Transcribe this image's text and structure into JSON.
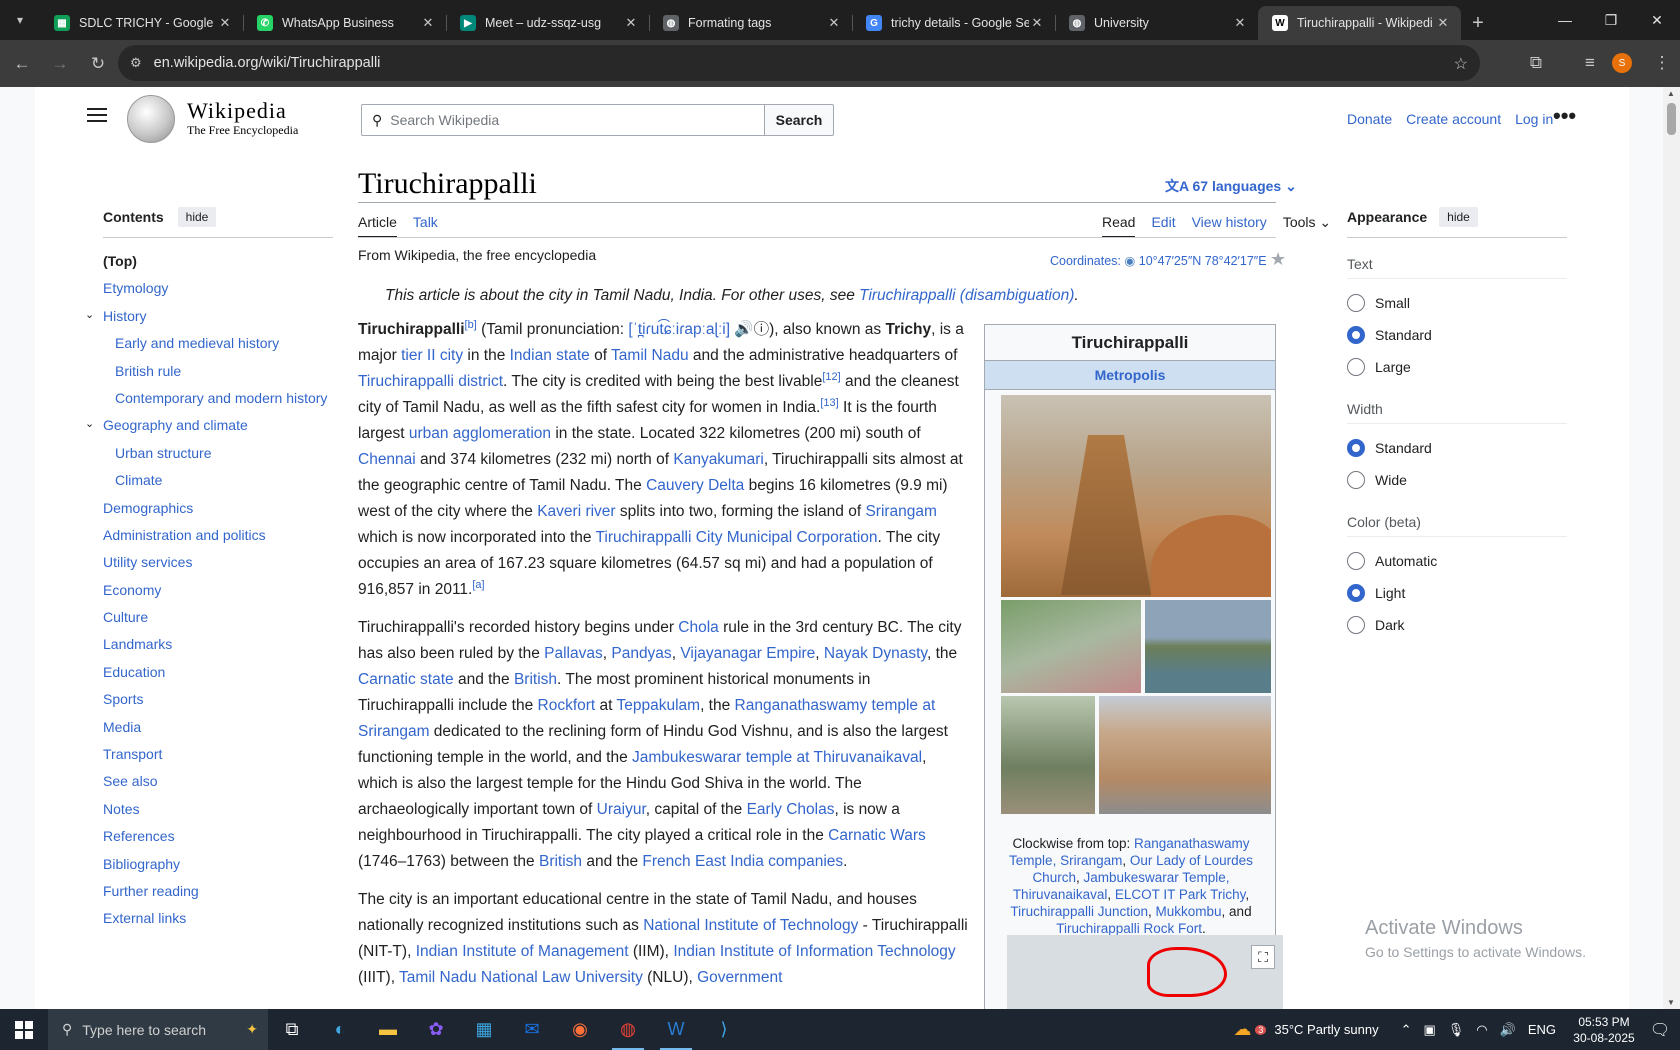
{
  "browser": {
    "tabs": [
      {
        "title": "SDLC TRICHY - Google Sh",
        "icon": "sheets-icon",
        "color": "#0f9d58",
        "glyph": "▦"
      },
      {
        "title": "WhatsApp Business",
        "icon": "whatsapp-icon",
        "color": "#25d366",
        "glyph": "✆"
      },
      {
        "title": "Meet – udz-ssqz-usg",
        "icon": "meet-icon",
        "color": "#00897b",
        "glyph": "▶"
      },
      {
        "title": "Formating tags",
        "icon": "globe-icon",
        "color": "#5f6368",
        "glyph": "◍"
      },
      {
        "title": "trichy details - Google Se",
        "icon": "google-icon",
        "color": "#4285f4",
        "glyph": "G"
      },
      {
        "title": "University",
        "icon": "globe-icon",
        "color": "#5f6368",
        "glyph": "◍"
      },
      {
        "title": "Tiruchirappalli - Wikipedi",
        "icon": "wikipedia-icon",
        "color": "#ffffff",
        "glyph": "W"
      }
    ],
    "active_tab": 6,
    "url": "en.wikipedia.org/wiki/Tiruchirappalli",
    "profile_initial": "S"
  },
  "header": {
    "wordmark": "Wikipedia",
    "tagline": "The Free Encyclopedia",
    "search_placeholder": "Search Wikipedia",
    "search_button": "Search",
    "links": [
      "Donate",
      "Create account",
      "Log in"
    ]
  },
  "toc": {
    "heading": "Contents",
    "hide": "hide",
    "items": [
      {
        "label": "(Top)",
        "level": 0,
        "top": true
      },
      {
        "label": "Etymology",
        "level": 0
      },
      {
        "label": "History",
        "level": 0,
        "caret": true
      },
      {
        "label": "Early and medieval history",
        "level": 1
      },
      {
        "label": "British rule",
        "level": 1
      },
      {
        "label": "Contemporary and modern history",
        "level": 1
      },
      {
        "label": "Geography and climate",
        "level": 0,
        "caret": true
      },
      {
        "label": "Urban structure",
        "level": 1
      },
      {
        "label": "Climate",
        "level": 1
      },
      {
        "label": "Demographics",
        "level": 0
      },
      {
        "label": "Administration and politics",
        "level": 0
      },
      {
        "label": "Utility services",
        "level": 0
      },
      {
        "label": "Economy",
        "level": 0
      },
      {
        "label": "Culture",
        "level": 0
      },
      {
        "label": "Landmarks",
        "level": 0
      },
      {
        "label": "Education",
        "level": 0
      },
      {
        "label": "Sports",
        "level": 0
      },
      {
        "label": "Media",
        "level": 0
      },
      {
        "label": "Transport",
        "level": 0
      },
      {
        "label": "See also",
        "level": 0
      },
      {
        "label": "Notes",
        "level": 0
      },
      {
        "label": "References",
        "level": 0
      },
      {
        "label": "Bibliography",
        "level": 0
      },
      {
        "label": "Further reading",
        "level": 0
      },
      {
        "label": "External links",
        "level": 0
      }
    ]
  },
  "article": {
    "title": "Tiruchirappalli",
    "languages": "67 languages",
    "tabs_left": [
      "Article",
      "Talk"
    ],
    "tabs_right": [
      "Read",
      "Edit",
      "View history",
      "Tools"
    ],
    "from": "From Wikipedia, the free encyclopedia",
    "coordinates_label": "Coordinates:",
    "coordinates": "10°47′25″N 78°42′17″E",
    "hatnote_prefix": "This article is about the city in Tamil Nadu, India. For other uses, see ",
    "hatnote_link": "Tiruchirappalli (disambiguation)",
    "hatnote_suffix": "."
  },
  "paragraphs": [
    [
      {
        "t": "Tiruchirappalli",
        "b": true
      },
      {
        "t": "[b]",
        "s": true
      },
      {
        "t": " (Tamil pronunciation: "
      },
      {
        "t": "[ˈt̪iɾut͡ɕːiɾapːaɭːi]",
        "l": true
      },
      {
        "t": " 🔊ⓘ), also known as "
      },
      {
        "t": "Trichy",
        "b": true
      },
      {
        "t": ", is a major "
      },
      {
        "t": "tier II city",
        "l": true
      },
      {
        "t": " in the "
      },
      {
        "t": "Indian state",
        "l": true
      },
      {
        "t": " of "
      },
      {
        "t": "Tamil Nadu",
        "l": true
      },
      {
        "t": " and the administrative headquarters of "
      },
      {
        "t": "Tiruchirappalli district",
        "l": true
      },
      {
        "t": ". The city is credited with being the best livable"
      },
      {
        "t": "[12]",
        "s": true
      },
      {
        "t": " and the cleanest city of Tamil Nadu, as well as the fifth safest city for women in India."
      },
      {
        "t": "[13]",
        "s": true
      },
      {
        "t": " It is the fourth largest "
      },
      {
        "t": "urban agglomeration",
        "l": true
      },
      {
        "t": " in the state. Located 322 kilometres (200 mi) south of "
      },
      {
        "t": "Chennai",
        "l": true
      },
      {
        "t": " and 374 kilometres (232 mi) north of "
      },
      {
        "t": "Kanyakumari",
        "l": true
      },
      {
        "t": ", Tiruchirappalli sits almost at the geographic centre of Tamil Nadu. The "
      },
      {
        "t": "Cauvery Delta",
        "l": true
      },
      {
        "t": " begins 16 kilometres (9.9 mi) west of the city where the "
      },
      {
        "t": "Kaveri river",
        "l": true
      },
      {
        "t": " splits into two, forming the island of "
      },
      {
        "t": "Srirangam",
        "l": true
      },
      {
        "t": " which is now incorporated into the "
      },
      {
        "t": "Tiruchirappalli City Municipal Corporation",
        "l": true
      },
      {
        "t": ". The city occupies an area of 167.23 square kilometres (64.57 sq mi) and had a population of 916,857 in 2011."
      },
      {
        "t": "[a]",
        "s": true
      }
    ],
    [
      {
        "t": "Tiruchirappalli's recorded history begins under "
      },
      {
        "t": "Chola",
        "l": true
      },
      {
        "t": " rule in the 3rd century BC. The city has also been ruled by the "
      },
      {
        "t": "Pallavas",
        "l": true
      },
      {
        "t": ", "
      },
      {
        "t": "Pandyas",
        "l": true
      },
      {
        "t": ", "
      },
      {
        "t": "Vijayanagar Empire",
        "l": true
      },
      {
        "t": ", "
      },
      {
        "t": "Nayak Dynasty",
        "l": true
      },
      {
        "t": ", the "
      },
      {
        "t": "Carnatic state",
        "l": true
      },
      {
        "t": " and the "
      },
      {
        "t": "British",
        "l": true
      },
      {
        "t": ". The most prominent historical monuments in Tiruchirappalli include the "
      },
      {
        "t": "Rockfort",
        "l": true
      },
      {
        "t": " at "
      },
      {
        "t": "Teppakulam",
        "l": true
      },
      {
        "t": ", the "
      },
      {
        "t": "Ranganathaswamy temple at Srirangam",
        "l": true
      },
      {
        "t": " dedicated to the reclining form of Hindu God Vishnu, and is also the largest functioning temple in the world, and the "
      },
      {
        "t": "Jambukeswarar temple at Thiruvanaikaval",
        "l": true
      },
      {
        "t": ", which is also the largest temple for the Hindu God Shiva in the world. The archaeologically important town of "
      },
      {
        "t": "Uraiyur",
        "l": true
      },
      {
        "t": ", capital of the "
      },
      {
        "t": "Early Cholas",
        "l": true
      },
      {
        "t": ", is now a neighbourhood in Tiruchirappalli. The city played a critical role in the "
      },
      {
        "t": "Carnatic Wars",
        "l": true
      },
      {
        "t": " (1746–1763) between the "
      },
      {
        "t": "British",
        "l": true
      },
      {
        "t": " and the "
      },
      {
        "t": "French East India companies",
        "l": true
      },
      {
        "t": "."
      }
    ],
    [
      {
        "t": "The city is an important educational centre in the state of Tamil Nadu, and houses nationally recognized institutions such as "
      },
      {
        "t": "National Institute of Technology",
        "l": true
      },
      {
        "t": " - Tiruchirappalli (NIT-T), "
      },
      {
        "t": "Indian Institute of Management",
        "l": true
      },
      {
        "t": " (IIM), "
      },
      {
        "t": "Indian Institute of Information Technology",
        "l": true
      },
      {
        "t": " (IIIT), "
      },
      {
        "t": "Tamil Nadu National Law University",
        "l": true
      },
      {
        "t": " (NLU), "
      },
      {
        "t": "Government",
        "l": true
      }
    ]
  ],
  "infobox": {
    "title": "Tiruchirappalli",
    "subtitle": "Metropolis",
    "caption": [
      {
        "t": "Clockwise from top: "
      },
      {
        "t": "Ranganathaswamy Temple, Srirangam",
        "l": true
      },
      {
        "t": ", "
      },
      {
        "t": "Our Lady of Lourdes Church",
        "l": true
      },
      {
        "t": ", "
      },
      {
        "t": "Jambukeswarar Temple, Thiruvanaikaval",
        "l": true
      },
      {
        "t": ", "
      },
      {
        "t": "ELCOT IT Park Trichy",
        "l": true
      },
      {
        "t": ", "
      },
      {
        "t": "Tiruchirappalli Junction",
        "l": true
      },
      {
        "t": ", "
      },
      {
        "t": "Mukkombu",
        "l": true
      },
      {
        "t": ", and "
      },
      {
        "t": "Tiruchirappalli Rock Fort",
        "l": true
      },
      {
        "t": "."
      }
    ]
  },
  "appearance": {
    "heading": "Appearance",
    "hide": "hide",
    "groups": [
      {
        "label": "Text",
        "options": [
          "Small",
          "Standard",
          "Large"
        ],
        "selected": 1
      },
      {
        "label": "Width",
        "options": [
          "Standard",
          "Wide"
        ],
        "selected": 0
      },
      {
        "label": "Color (beta)",
        "options": [
          "Automatic",
          "Light",
          "Dark"
        ],
        "selected": 1
      }
    ]
  },
  "watermark": {
    "line1": "Activate Windows",
    "line2": "Go to Settings to activate Windows."
  },
  "taskbar": {
    "search_placeholder": "Type here to search",
    "weather": "35°C  Partly sunny",
    "language": "ENG",
    "time": "05:53 PM",
    "date": "30-08-2025",
    "weather_badge": "3"
  }
}
